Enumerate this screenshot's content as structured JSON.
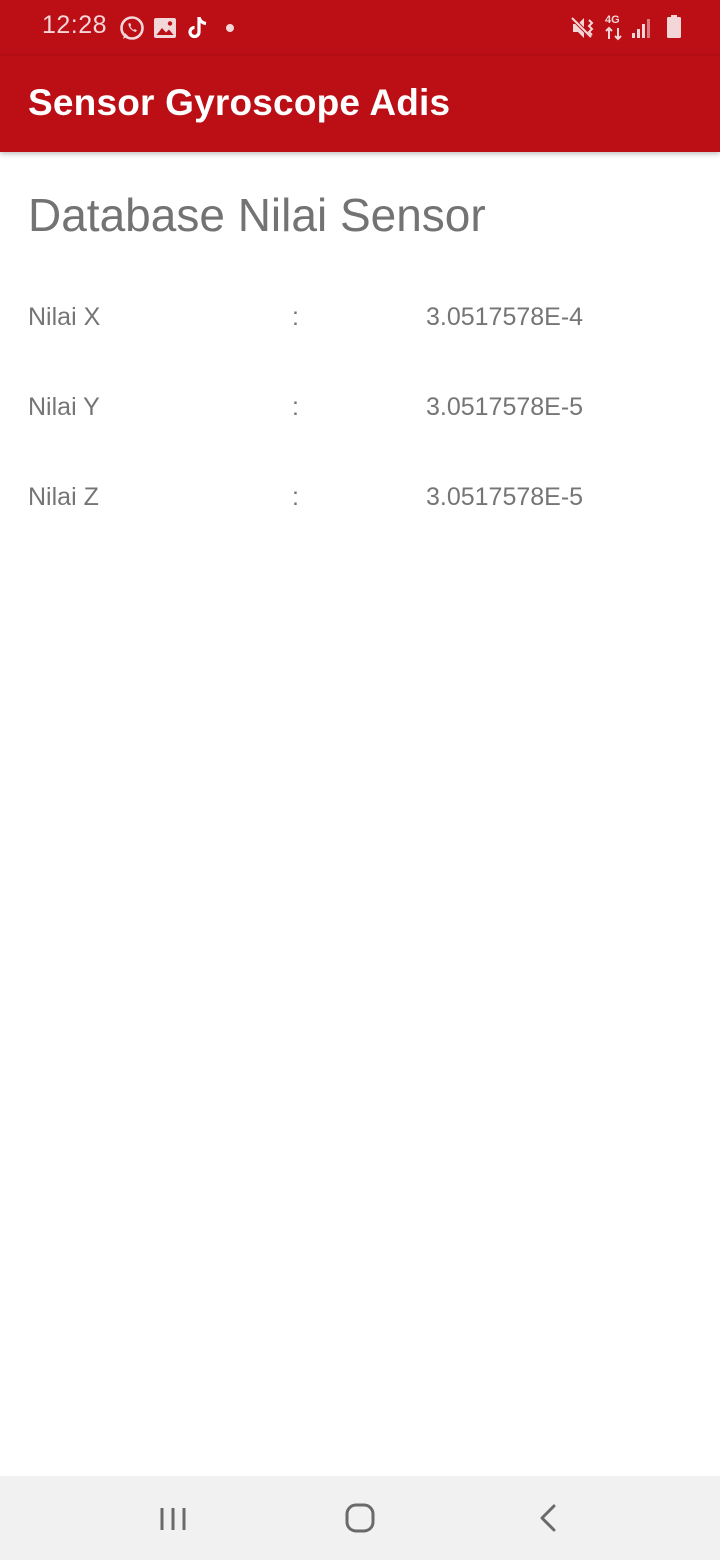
{
  "status_bar": {
    "time": "12:28",
    "icons": [
      "whatsapp-icon",
      "gallery-icon",
      "tiktok-icon",
      "notification-dot-icon",
      "mute-vibrate-icon",
      "network-4g-icon",
      "signal-icon",
      "battery-icon"
    ],
    "network_label": "4G",
    "background": "#bb0e15"
  },
  "app_bar": {
    "title": "Sensor Gyroscope Adis",
    "background": "#bb0e15"
  },
  "main": {
    "title": "Database Nilai Sensor",
    "rows": [
      {
        "label": "Nilai X",
        "separator": ":",
        "value": "3.0517578E-4"
      },
      {
        "label": "Nilai Y",
        "separator": ":",
        "value": "3.0517578E-5"
      },
      {
        "label": "Nilai Z",
        "separator": ":",
        "value": "3.0517578E-5"
      }
    ]
  },
  "nav_bar": {
    "buttons": [
      "recent-apps-icon",
      "home-icon",
      "back-icon"
    ]
  }
}
